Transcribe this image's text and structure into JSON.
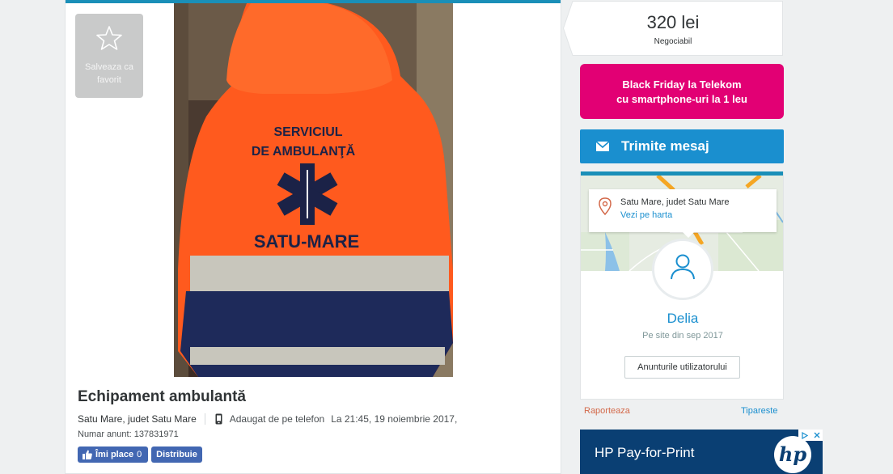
{
  "listing": {
    "favorite_label": "Salveaza ca favorit",
    "title": "Echipament ambulantă",
    "location": "Satu Mare, judet Satu Mare",
    "added_from": "Adaugat de pe telefon",
    "added_at": "La 21:45, 19 noiembrie 2017,",
    "ad_number": "Numar anunt: 137831971",
    "photo_text_line1": "SERVICIUL",
    "photo_text_line2": "DE AMBULANŢĂ",
    "photo_text_line3": "SATU-MARE"
  },
  "social": {
    "like_label": "Îmi place",
    "like_count": "0",
    "share_label": "Distribuie"
  },
  "price": {
    "amount": "320 lei",
    "note": "Negociabil"
  },
  "promo": {
    "line1": "Black Friday la Telekom",
    "line2": "cu smartphone-uri la 1 leu",
    "color": "#e20074"
  },
  "message_button": "Trimite mesaj",
  "seller": {
    "location": "Satu Mare, judet Satu Mare",
    "map_link": "Vezi pe harta",
    "name": "Delia",
    "member_since": "Pe site din sep 2017",
    "user_ads_button": "Anunturile utilizatorului"
  },
  "footer_links": {
    "report": "Raporteaza",
    "print": "Tipareste"
  },
  "ad": {
    "text": "HP Pay-for-Print",
    "logo_text": "hp"
  },
  "colors": {
    "accent": "#1a8fcf",
    "topbar": "#1a8fb8",
    "fb": "#4267b2"
  }
}
